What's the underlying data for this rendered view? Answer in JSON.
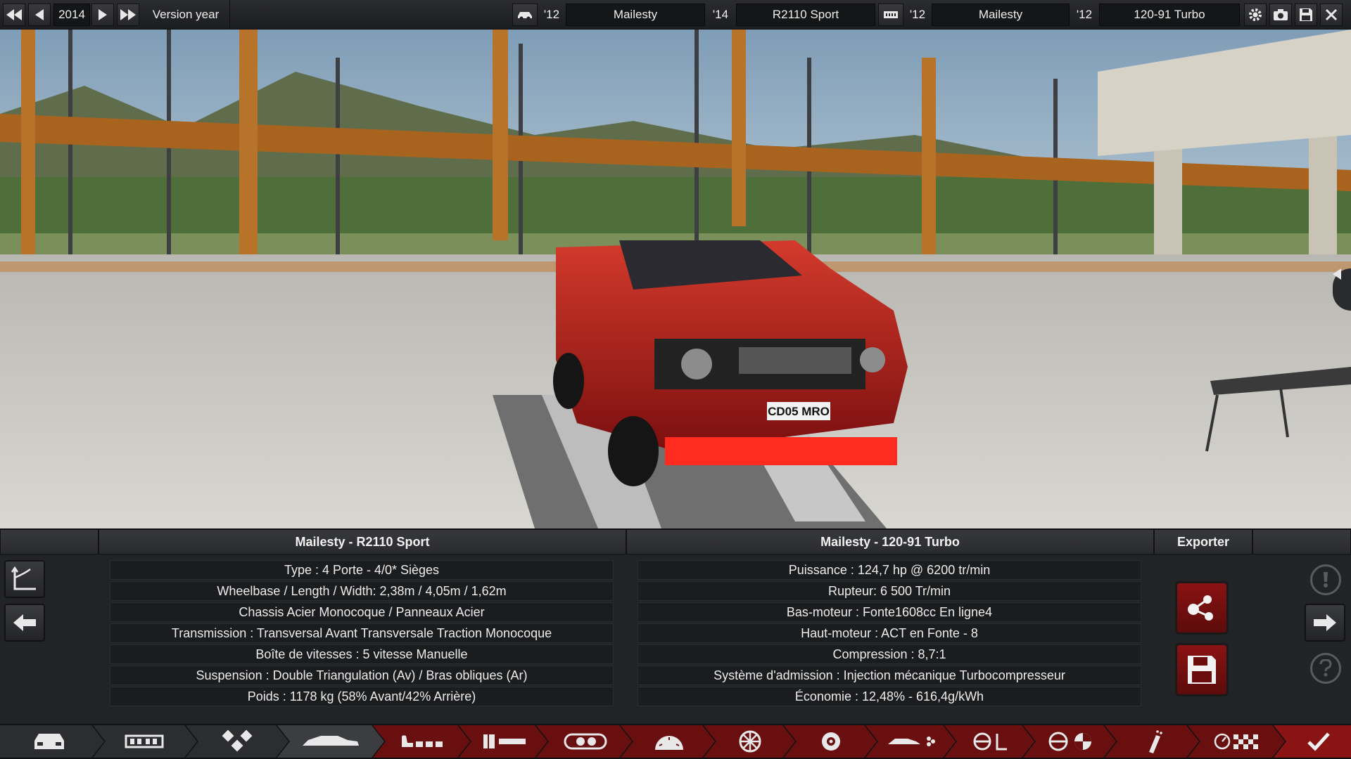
{
  "topbar": {
    "year": "2014",
    "version_label": "Version year",
    "left_car": {
      "model_year": "'12",
      "model": "Mailesty",
      "trim_year": "'14",
      "trim": "R2110 Sport"
    },
    "right_car": {
      "model_year": "'12",
      "model": "Mailesty",
      "engine_year": "'12",
      "engine": "120-91 Turbo"
    }
  },
  "scene": {
    "plate": "CD05 MRO",
    "car_color": "#b51c1c"
  },
  "panel": {
    "car_header": "Mailesty - R2110 Sport",
    "engine_header": "Mailesty - 120-91 Turbo",
    "export_header": "Exporter",
    "car_specs": [
      "Type : 4 Porte - 4/0* Sièges",
      "Wheelbase / Length / Width: 2,38m / 4,05m / 1,62m",
      "Chassis Acier Monocoque / Panneaux Acier",
      "Transmission : Transversal Avant Transversale Traction Monocoque",
      "Boîte de vitesses : 5 vitesse Manuelle",
      "Suspension : Double Triangulation (Av) / Bras obliques (Ar)",
      "Poids : 1178 kg (58% Avant/42% Arrière)"
    ],
    "engine_specs": [
      "Puissance : 124,7 hp @ 6200 tr/min",
      "Rupteur: 6 500 Tr/min",
      "Bas-moteur : Fonte1608cc En ligne4",
      "Haut-moteur : ACT en Fonte - 8",
      "Compression : 8,7:1",
      "Système d'admission : Injection mécanique Turbocompresseur",
      "Économie : 12,48% - 616,4g/kWh"
    ]
  },
  "colors": {
    "accent_red": "#8a1313",
    "panel_bg": "#222325",
    "row_bg": "#1b1c1e"
  }
}
